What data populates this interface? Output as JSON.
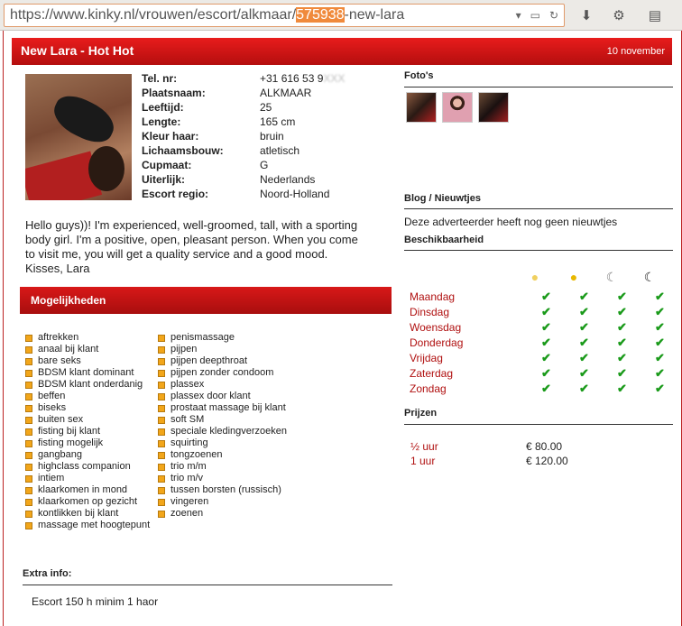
{
  "browser": {
    "url_prefix": "https://www.kinky.nl/vrouwen/escort/alkmaar/",
    "url_highlight": "575938",
    "url_suffix": "-new-lara"
  },
  "header": {
    "title": "New Lara - Hot Hot",
    "date": "10 november"
  },
  "details": [
    {
      "label": "Tel. nr:",
      "value": "+31 616 53 9"
    },
    {
      "label": "Plaatsnaam:",
      "value": "ALKMAAR"
    },
    {
      "label": "Leeftijd:",
      "value": "25"
    },
    {
      "label": "Lengte:",
      "value": "165 cm"
    },
    {
      "label": "Kleur haar:",
      "value": "bruin"
    },
    {
      "label": "Lichaamsbouw:",
      "value": "atletisch"
    },
    {
      "label": "Cupmaat:",
      "value": "G"
    },
    {
      "label": "Uiterlijk:",
      "value": "Nederlands"
    },
    {
      "label": "Escort regio:",
      "value": "Noord-Holland"
    }
  ],
  "intro": "Hello guys))! I'm experienced, well-groomed, tall, with a sporting body girl. I'm a positive, open, pleasant person. When you come to visit me, you will get a quality service and a good mood. Kisses, Lara",
  "mogelijkheden": {
    "title": "Mogelijkheden",
    "col1": [
      "aftrekken",
      "anaal bij klant",
      "bare seks",
      "BDSM klant dominant",
      "BDSM klant onderdanig",
      "beffen",
      "biseks",
      "buiten sex",
      "fisting bij klant",
      "fisting mogelijk",
      "gangbang",
      "highclass companion",
      "intiem",
      "klaarkomen in mond",
      "klaarkomen op gezicht",
      "kontlikken bij klant",
      "massage met hoogtepunt"
    ],
    "col2": [
      "penismassage",
      "pijpen",
      "pijpen deepthroat",
      "pijpen zonder condoom",
      "plassex",
      "plassex door klant",
      "prostaat massage bij klant",
      "soft SM",
      "speciale kledingverzoeken",
      "squirting",
      "tongzoenen",
      "trio m/m",
      "trio m/v",
      "tussen borsten (russisch)",
      "vingeren",
      "zoenen"
    ]
  },
  "extra": {
    "title": "Extra info:",
    "value": "Escort 150 h minim 1 haor"
  },
  "fotos": {
    "title": "Foto's"
  },
  "blog": {
    "title": "Blog / Nieuwtjes",
    "text": "Deze adverteerder heeft nog geen nieuwtjes"
  },
  "beschikbaarheid": {
    "title": "Beschikbaarheid",
    "days": [
      "Maandag",
      "Dinsdag",
      "Woensdag",
      "Donderdag",
      "Vrijdag",
      "Zaterdag",
      "Zondag"
    ],
    "check": "✔"
  },
  "prijzen": {
    "title": "Prijzen",
    "rows": [
      {
        "unit": "½  uur",
        "price": "€ 80.00"
      },
      {
        "unit": "1  uur",
        "price": "€ 120.00"
      }
    ]
  }
}
